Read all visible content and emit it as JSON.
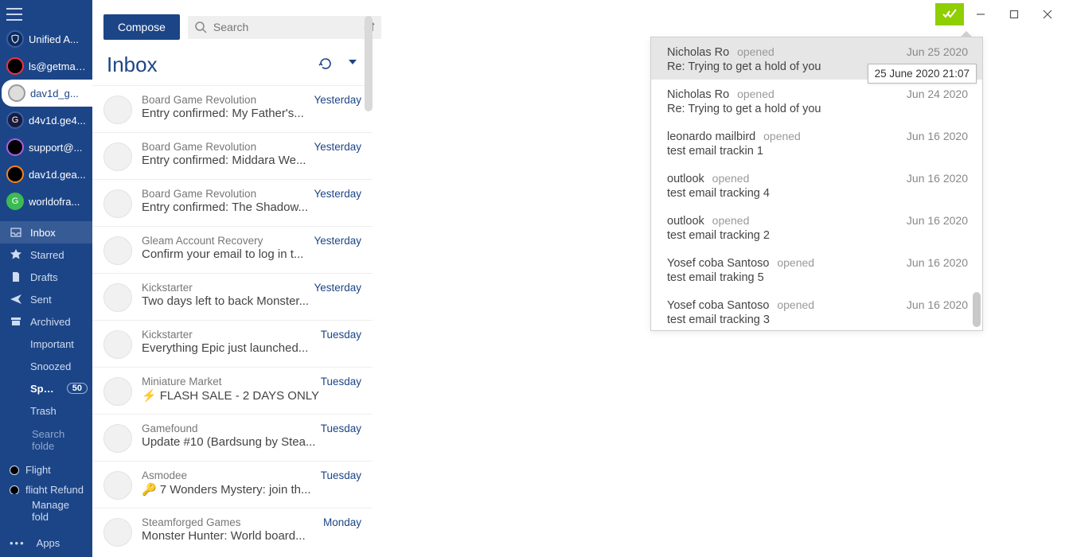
{
  "sidebar": {
    "accounts": [
      {
        "label": "Unified A...",
        "avatar_bg": "#0c2a5c",
        "avatar_text": "",
        "avatar_border": "#3a5fa3",
        "active": false,
        "icon": "shield"
      },
      {
        "label": "ls@getmail...",
        "avatar_bg": "#000",
        "avatar_text": "",
        "avatar_border": "#e34",
        "active": false,
        "icon": "ring-red"
      },
      {
        "label": "dav1d_g...",
        "avatar_bg": "#ddd",
        "avatar_text": "",
        "avatar_border": "#999",
        "active": true,
        "icon": "photo"
      },
      {
        "label": "d4v1d.ge4...",
        "avatar_bg": "#1a1a3a",
        "avatar_text": "G",
        "avatar_border": "#3a5fa3",
        "active": false,
        "icon": "g-blue"
      },
      {
        "label": "support@...",
        "avatar_bg": "#000",
        "avatar_text": "",
        "avatar_border": "#b25ce6",
        "active": false,
        "icon": "ring-purple"
      },
      {
        "label": "dav1d.gea...",
        "avatar_bg": "#000",
        "avatar_text": "",
        "avatar_border": "#f58220",
        "active": false,
        "icon": "ring-orange"
      },
      {
        "label": "worldofra...",
        "avatar_bg": "#3cba54",
        "avatar_text": "G",
        "avatar_border": "#3cba54",
        "active": false,
        "icon": "g-green"
      }
    ],
    "folders": [
      {
        "icon": "inbox",
        "label": "Inbox",
        "selected": true
      },
      {
        "icon": "star",
        "label": "Starred"
      },
      {
        "icon": "file",
        "label": "Drafts"
      },
      {
        "icon": "send",
        "label": "Sent"
      },
      {
        "icon": "archive",
        "label": "Archived"
      },
      {
        "icon": "",
        "label": "Important"
      },
      {
        "icon": "",
        "label": "Snoozed"
      },
      {
        "icon": "",
        "label": "Spam",
        "badge": "50",
        "bold": true
      },
      {
        "icon": "",
        "label": "Trash"
      }
    ],
    "search_placeholder": "Search folde",
    "custom": [
      {
        "label": "Flight"
      },
      {
        "label": "flight Refund"
      }
    ],
    "manage_label": "Manage fold",
    "apps_label": "Apps"
  },
  "toolbar": {
    "compose_label": "Compose",
    "search_placeholder": "Search"
  },
  "list": {
    "title": "Inbox",
    "messages": [
      {
        "sender": "Board Game Revolution",
        "date": "Yesterday",
        "subject": "Entry confirmed: My Father's..."
      },
      {
        "sender": "Board Game Revolution",
        "date": "Yesterday",
        "subject": "Entry confirmed: Middara We..."
      },
      {
        "sender": "Board Game Revolution",
        "date": "Yesterday",
        "subject": "Entry confirmed: The Shadow..."
      },
      {
        "sender": "Gleam Account Recovery",
        "date": "Yesterday",
        "subject": "Confirm your email to log in t..."
      },
      {
        "sender": "Kickstarter",
        "date": "Yesterday",
        "subject": "Two days left to back Monster..."
      },
      {
        "sender": "Kickstarter",
        "date": "Tuesday",
        "subject": "Everything Epic just launched..."
      },
      {
        "sender": "Miniature Market",
        "date": "Tuesday",
        "subject": "FLASH SALE - 2 DAYS ONLY",
        "icon": "bolt"
      },
      {
        "sender": "Gamefound",
        "date": "Tuesday",
        "subject": "Update #10 (Bardsung by Stea..."
      },
      {
        "sender": "Asmodee",
        "date": "Tuesday",
        "subject": "7 Wonders Mystery: join th...",
        "icon": "key"
      },
      {
        "sender": "Steamforged Games",
        "date": "Monday",
        "subject": "Monster Hunter: World board..."
      }
    ]
  },
  "tracker": {
    "tooltip": "25 June 2020 21:07",
    "items": [
      {
        "name": "Nicholas Ro",
        "status": "opened",
        "date": "Jun 25 2020",
        "subject": "Re: Trying to get a hold of you",
        "selected": true
      },
      {
        "name": "Nicholas Ro",
        "status": "opened",
        "date": "Jun 24 2020",
        "subject": "Re: Trying to get a hold of you"
      },
      {
        "name": "leonardo mailbird",
        "status": "opened",
        "date": "Jun 16 2020",
        "subject": "test email trackin 1"
      },
      {
        "name": "outlook",
        "status": "opened",
        "date": "Jun 16 2020",
        "subject": "test email tracking 4"
      },
      {
        "name": "outlook",
        "status": "opened",
        "date": "Jun 16 2020",
        "subject": "test email tracking 2"
      },
      {
        "name": "Yosef coba Santoso",
        "status": "opened",
        "date": "Jun 16 2020",
        "subject": "test email traking 5"
      },
      {
        "name": "Yosef coba Santoso",
        "status": "opened",
        "date": "Jun 16 2020",
        "subject": "test email tracking 3"
      }
    ]
  }
}
